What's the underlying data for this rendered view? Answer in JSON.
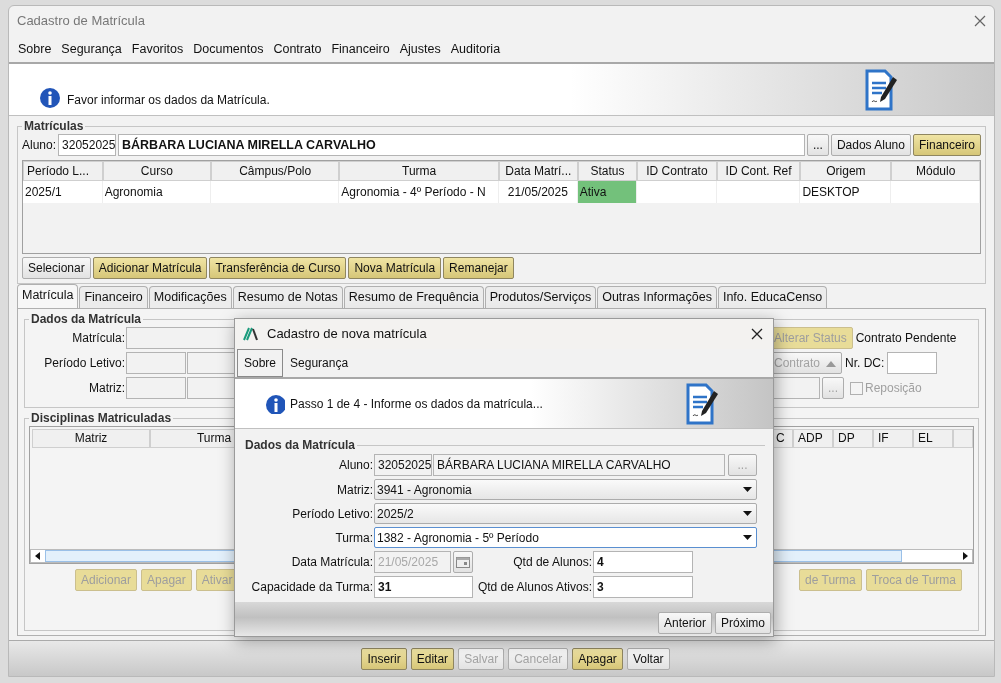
{
  "window": {
    "title": "Cadastro de Matrícula"
  },
  "menu": [
    "Sobre",
    "Segurança",
    "Favoritos",
    "Documentos",
    "Contrato",
    "Financeiro",
    "Ajustes",
    "Auditoria"
  ],
  "banner": {
    "message": "Favor informar os dados da Matrícula."
  },
  "enrollments": {
    "title": "Matrículas",
    "student_label": "Aluno:",
    "student_id": "32052025",
    "student_name": "BÁRBARA LUCIANA MIRELLA CARVALHO",
    "lookup_button": "...",
    "buttons": [
      {
        "label": "Dados Aluno",
        "kind": "plain",
        "disabled": false
      },
      {
        "label": "Financeiro",
        "kind": "gold",
        "disabled": false
      }
    ],
    "table": {
      "columns": [
        "Período L...",
        "Curso",
        "Câmpus/Polo",
        "Turma",
        "Data Matrí...",
        "Status",
        "ID Contrato",
        "ID Cont. Ref",
        "Origem",
        "Módulo"
      ],
      "rows": [
        {
          "cells": [
            "2025/1",
            "Agronomia",
            null,
            "Agronomia - 4º Período - N",
            "21/05/2025",
            {
              "text": "Ativa",
              "color": "#73c17b"
            },
            null,
            null,
            "DESKTOP",
            null
          ]
        }
      ]
    },
    "actions": [
      {
        "label": "Selecionar",
        "kind": "plain",
        "disabled": false
      },
      {
        "label": "Adicionar Matrícula",
        "kind": "gold",
        "disabled": false
      },
      {
        "label": "Transferência de Curso",
        "kind": "gold",
        "disabled": false
      },
      {
        "label": "Nova Matrícula",
        "kind": "gold",
        "disabled": false
      },
      {
        "label": "Remanejar",
        "kind": "gold",
        "disabled": false
      }
    ]
  },
  "tabs": [
    {
      "label": "Matrícula",
      "selected": true
    },
    {
      "label": "Financeiro",
      "selected": false
    },
    {
      "label": "Modificações",
      "selected": false
    },
    {
      "label": "Resumo de Notas",
      "selected": false
    },
    {
      "label": "Resumo de Frequência",
      "selected": false
    },
    {
      "label": "Produtos/Serviços",
      "selected": false
    },
    {
      "label": "Outras Informações",
      "selected": false
    },
    {
      "label": "Info. EducaCenso",
      "selected": false
    }
  ],
  "enrollment_data": {
    "title": "Dados da Matrícula",
    "labels": [
      "Matrícula:",
      "Período Letivo:",
      "Matriz:"
    ],
    "status_button": {
      "label": "Alterar Status",
      "kind": "gold",
      "disabled": true
    },
    "contract_status": "Contrato Pendente",
    "contract_button": {
      "label": "Contrato",
      "kind": "plain",
      "disabled": true
    },
    "dc_label": "Nr. DC:",
    "lookup_button": "...",
    "replacement": {
      "label": "Reposição",
      "checked": false,
      "disabled": true
    }
  },
  "subjects": {
    "title": "Disciplinas Matriculadas",
    "columns_left": [
      "Matriz",
      "Turma"
    ],
    "columns_right": [
      "C",
      "ADP",
      "DP",
      "IF",
      "EL"
    ],
    "actions_left": [
      {
        "label": "Adicionar",
        "kind": "gold",
        "disabled": true
      },
      {
        "label": "Apagar",
        "kind": "gold",
        "disabled": true
      },
      {
        "label": "Ativar",
        "kind": "gold",
        "disabled": true
      }
    ],
    "actions_right": [
      {
        "label": "de Turma",
        "kind": "gold",
        "disabled": true
      },
      {
        "label": "Troca de Turma",
        "kind": "gold",
        "disabled": true
      }
    ]
  },
  "footer_buttons": [
    {
      "label": "Inserir",
      "kind": "gold",
      "disabled": false
    },
    {
      "label": "Editar",
      "kind": "gold",
      "disabled": false
    },
    {
      "label": "Salvar",
      "kind": "plain",
      "disabled": true
    },
    {
      "label": "Cancelar",
      "kind": "plain",
      "disabled": true
    },
    {
      "label": "Apagar",
      "kind": "gold",
      "disabled": false
    },
    {
      "label": "Voltar",
      "kind": "plain",
      "disabled": false
    }
  ],
  "dialog": {
    "title": "Cadastro de nova matrícula",
    "menu": [
      {
        "label": "Sobre",
        "selected": true
      },
      {
        "label": "Segurança",
        "selected": false
      }
    ],
    "banner": "Passo 1 de 4 - Informe os dados da matrícula...",
    "group_title": "Dados da Matrícula",
    "student": {
      "label": "Aluno:",
      "id": "32052025",
      "name": "BÁRBARA LUCIANA MIRELLA CARVALHO",
      "lookup_button": "..."
    },
    "selects": [
      {
        "label": "Matriz:",
        "value": "3941 - Agronomia",
        "focused": false
      },
      {
        "label": "Período Letivo:",
        "value": "2025/2",
        "focused": false
      },
      {
        "label": "Turma:",
        "value": "1382 - Agronomia - 5º Período",
        "focused": true
      }
    ],
    "date": {
      "label": "Data Matrícula:",
      "value": "21/05/2025",
      "disabled": true
    },
    "counts": [
      {
        "label": "Qtd de Alunos:",
        "value": "4"
      },
      {
        "label": "Capacidade da Turma:",
        "value": "31"
      },
      {
        "label": "Qtd de Alunos Ativos:",
        "value": "3"
      }
    ],
    "buttons": [
      {
        "label": "Anterior",
        "kind": "plain",
        "disabled": false
      },
      {
        "label": "Próximo",
        "kind": "plain",
        "disabled": false
      }
    ]
  }
}
